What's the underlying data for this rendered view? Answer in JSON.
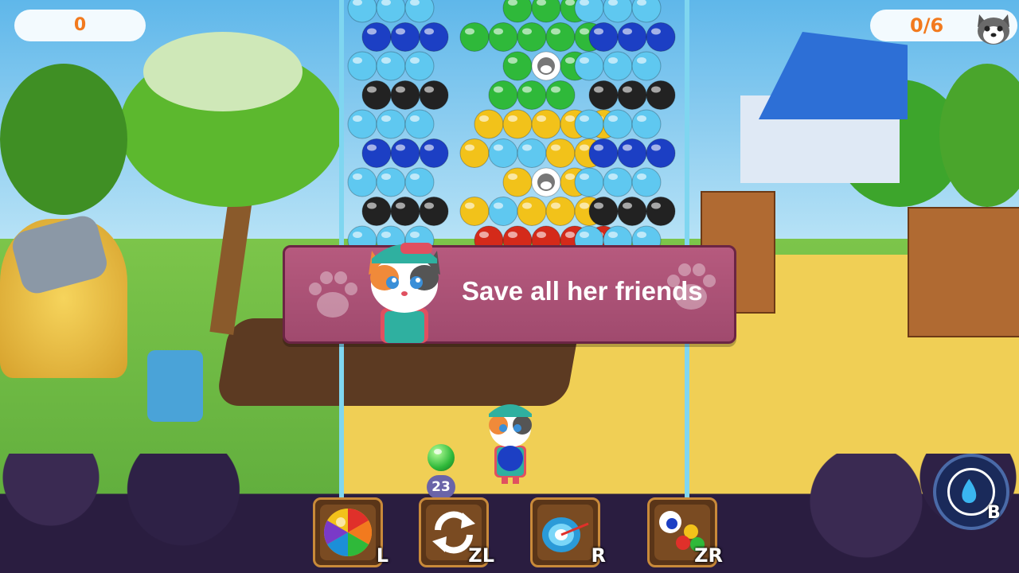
{
  "hud": {
    "score": "0",
    "friends_saved": "0/6",
    "friend_icon": "husky-face-icon"
  },
  "banner": {
    "message": "Save all her friends",
    "character_icon": "cat-girl-character",
    "decoration_icon": "paw-print-icon"
  },
  "shooter": {
    "next_bubble_color": "#2fb93a",
    "shots_remaining": "23"
  },
  "powerups": [
    {
      "name": "rainbow-bubble",
      "icon": "rainbow-ball-icon",
      "key": "L"
    },
    {
      "name": "swap-bubble",
      "icon": "swap-arrows-icon",
      "key": "ZL"
    },
    {
      "name": "target-aim",
      "icon": "target-icon",
      "key": "R"
    },
    {
      "name": "color-bomb",
      "icon": "multi-bubble-icon",
      "key": "ZR"
    }
  ],
  "special_button": {
    "icon": "water-drop-icon",
    "key": "B"
  },
  "colors": {
    "cyan": "#5fc8f0",
    "blue": "#1c3fc4",
    "black": "#222222",
    "green": "#2fb93a",
    "yellow": "#f2c21a",
    "red": "#d42a1a",
    "banner": "#a84c72"
  }
}
